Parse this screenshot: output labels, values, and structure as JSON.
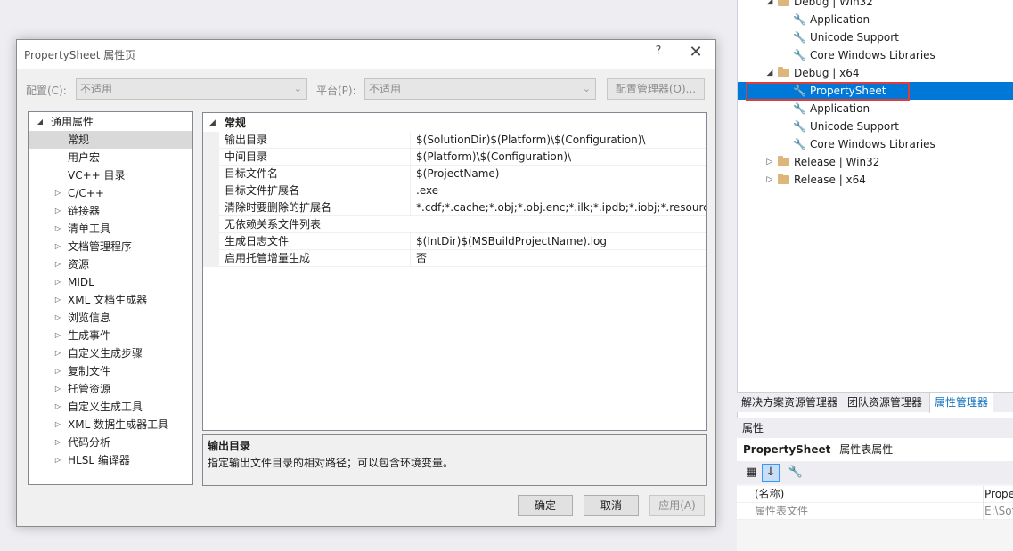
{
  "solution_tree": {
    "items": [
      {
        "label": "Debug | Win32",
        "type": "folder",
        "expanded": true
      },
      {
        "label": "Application",
        "type": "sheet"
      },
      {
        "label": "Unicode Support",
        "type": "sheet"
      },
      {
        "label": "Core Windows Libraries",
        "type": "sheet"
      },
      {
        "label": "Debug | x64",
        "type": "folder",
        "expanded": true
      },
      {
        "label": "PropertySheet",
        "type": "sheet",
        "selected": true
      },
      {
        "label": "Application",
        "type": "sheet"
      },
      {
        "label": "Unicode Support",
        "type": "sheet"
      },
      {
        "label": "Core Windows Libraries",
        "type": "sheet"
      },
      {
        "label": "Release | Win32",
        "type": "folder",
        "expanded": false
      },
      {
        "label": "Release | x64",
        "type": "folder",
        "expanded": false
      }
    ]
  },
  "panel_tabs": {
    "solution_explorer": "解决方案资源管理器",
    "team_explorer": "团队资源管理器",
    "property_manager": "属性管理器"
  },
  "properties_window": {
    "title": "属性",
    "object_name": "PropertySheet",
    "object_type": "属性表属性",
    "rows": [
      {
        "name": "(名称)",
        "value": "Prope"
      },
      {
        "name": "属性表文件",
        "value": "E:\\Sof"
      }
    ]
  },
  "dialog": {
    "title": "PropertySheet 属性页",
    "help": "?",
    "close": "✕",
    "config_label": "配置(C):",
    "config_value": "不适用",
    "platform_label": "平台(P):",
    "platform_value": "不适用",
    "config_manager": "配置管理器(O)...",
    "left_tree": [
      {
        "label": "通用属性",
        "expanded": true
      },
      {
        "label": "常规",
        "selected": true
      },
      {
        "label": "用户宏"
      },
      {
        "label": "VC++ 目录"
      },
      {
        "label": "C/C++"
      },
      {
        "label": "链接器"
      },
      {
        "label": "清单工具"
      },
      {
        "label": "文档管理程序"
      },
      {
        "label": "资源"
      },
      {
        "label": "MIDL"
      },
      {
        "label": "XML 文档生成器"
      },
      {
        "label": "浏览信息"
      },
      {
        "label": "生成事件"
      },
      {
        "label": "自定义生成步骤"
      },
      {
        "label": "复制文件"
      },
      {
        "label": "托管资源"
      },
      {
        "label": "自定义生成工具"
      },
      {
        "label": "XML 数据生成器工具"
      },
      {
        "label": "代码分析"
      },
      {
        "label": "HLSL 编译器"
      }
    ],
    "category": "常规",
    "properties": [
      {
        "name": "输出目录",
        "value": "$(SolutionDir)$(Platform)\\$(Configuration)\\"
      },
      {
        "name": "中间目录",
        "value": "$(Platform)\\$(Configuration)\\"
      },
      {
        "name": "目标文件名",
        "value": "$(ProjectName)"
      },
      {
        "name": "目标文件扩展名",
        "value": ".exe"
      },
      {
        "name": "清除时要删除的扩展名",
        "value": "*.cdf;*.cache;*.obj;*.obj.enc;*.ilk;*.ipdb;*.iobj;*.resources;*"
      },
      {
        "name": "无依赖关系文件列表",
        "value": ""
      },
      {
        "name": "生成日志文件",
        "value": "$(IntDir)$(MSBuildProjectName).log"
      },
      {
        "name": "启用托管增量生成",
        "value": "否"
      }
    ],
    "description_title": "输出目录",
    "description_text": "指定输出文件目录的相对路径；可以包含环境变量。",
    "ok": "确定",
    "cancel": "取消",
    "apply": "应用(A)"
  }
}
